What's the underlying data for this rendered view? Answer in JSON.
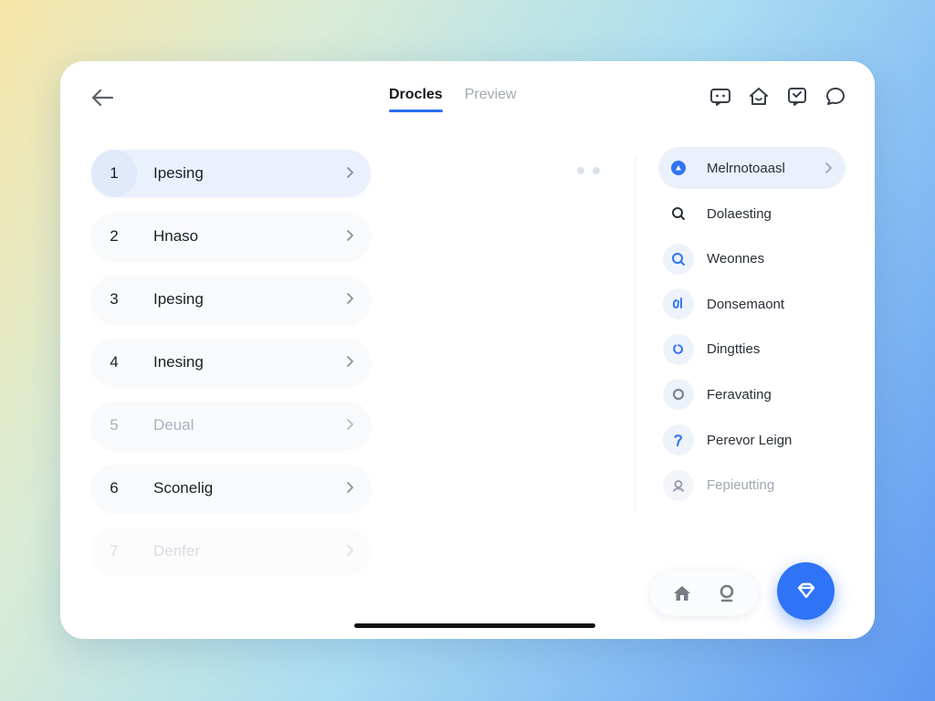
{
  "header": {
    "tabs": [
      {
        "label": "Drocles",
        "active": true
      },
      {
        "label": "Preview",
        "active": false
      }
    ],
    "icons": [
      "chat-square-icon",
      "home-outline-icon",
      "message-edit-icon",
      "chat-bubble-icon"
    ]
  },
  "left_list": [
    {
      "num": "1",
      "label": "Ipesing"
    },
    {
      "num": "2",
      "label": "Hnaso"
    },
    {
      "num": "3",
      "label": "Ipesing"
    },
    {
      "num": "4",
      "label": "Inesing"
    },
    {
      "num": "5",
      "label": "Deual"
    },
    {
      "num": "6",
      "label": "Sconelig"
    },
    {
      "num": "7",
      "label": "Denfer"
    }
  ],
  "right_list": [
    {
      "label": "Melrnotoaasl",
      "icon": "blue-dot-icon"
    },
    {
      "label": "Dolaesting",
      "icon": "search-icon"
    },
    {
      "label": "Weonnes",
      "icon": "search-icon"
    },
    {
      "label": "Donsemaont",
      "icon": "link-icon"
    },
    {
      "label": "Dingtties",
      "icon": "refresh-icon"
    },
    {
      "label": "Feravating",
      "icon": "circle-icon"
    },
    {
      "label": "Perevor Leign",
      "icon": "question-icon"
    },
    {
      "label": "Fepieutting",
      "icon": "user-icon"
    }
  ],
  "colors": {
    "accent": "#2f73f6",
    "selected_bg": "#eaf1fd",
    "text": "#1b1f26",
    "muted": "#a9b2bf"
  }
}
